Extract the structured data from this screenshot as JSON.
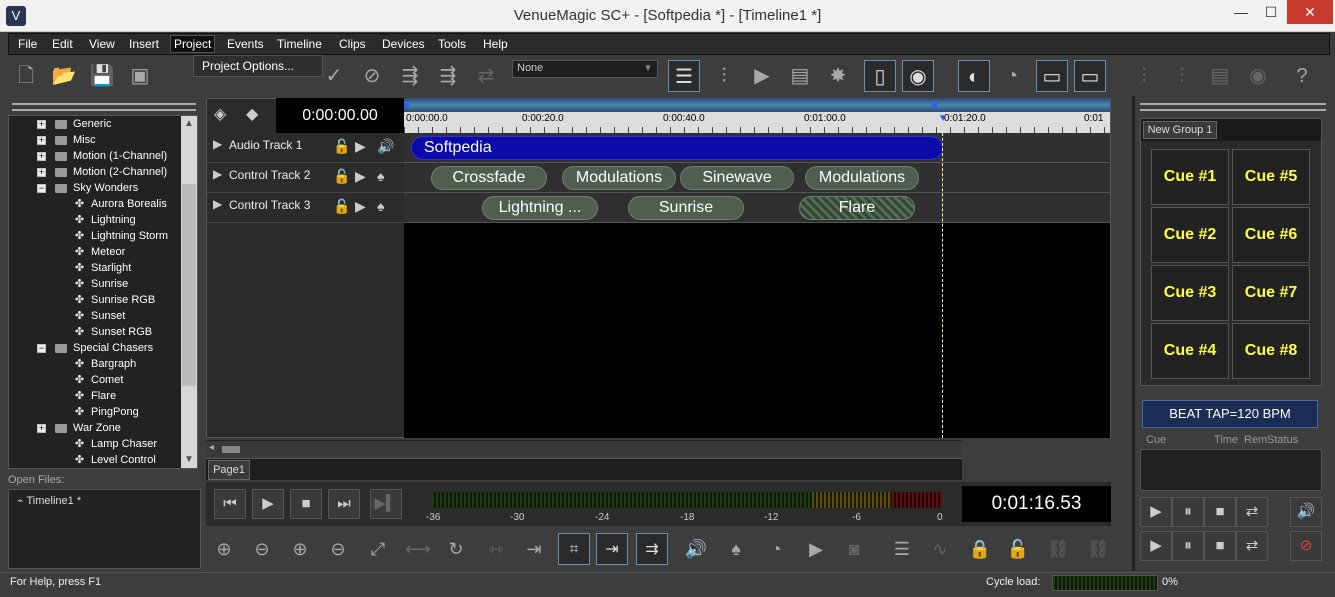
{
  "window": {
    "title": "VenueMagic SC+ - [Softpedia *] - [Timeline1 *]",
    "controls": {
      "minimize": "—",
      "maximize": "☐",
      "close": "✕"
    }
  },
  "menu": {
    "items": [
      "File",
      "Edit",
      "View",
      "Insert",
      "Project",
      "Events",
      "Timeline",
      "Clips",
      "Devices",
      "Tools",
      "Help"
    ],
    "active": "Project",
    "popup_item": "Project Options..."
  },
  "toolbar": {
    "dropdown_value": "None"
  },
  "tree": {
    "items": [
      {
        "label": "Generic",
        "type": "folder",
        "expander": "+"
      },
      {
        "label": "Misc",
        "type": "folder",
        "expander": "+"
      },
      {
        "label": "Motion (1-Channel)",
        "type": "folder",
        "expander": "+"
      },
      {
        "label": "Motion (2-Channel)",
        "type": "folder",
        "expander": "+"
      },
      {
        "label": "Sky Wonders",
        "type": "folder",
        "expander": "−"
      },
      {
        "label": "Aurora Borealis",
        "type": "effect"
      },
      {
        "label": "Lightning",
        "type": "effect"
      },
      {
        "label": "Lightning Storm",
        "type": "effect"
      },
      {
        "label": "Meteor",
        "type": "effect"
      },
      {
        "label": "Starlight",
        "type": "effect"
      },
      {
        "label": "Sunrise",
        "type": "effect"
      },
      {
        "label": "Sunrise RGB",
        "type": "effect"
      },
      {
        "label": "Sunset",
        "type": "effect"
      },
      {
        "label": "Sunset RGB",
        "type": "effect"
      },
      {
        "label": "Special Chasers",
        "type": "folder",
        "expander": "−"
      },
      {
        "label": "Bargraph",
        "type": "effect"
      },
      {
        "label": "Comet",
        "type": "effect"
      },
      {
        "label": "Flare",
        "type": "effect"
      },
      {
        "label": "PingPong",
        "type": "effect"
      },
      {
        "label": "War Zone",
        "type": "folder",
        "expander": "+"
      },
      {
        "label": "Lamp Chaser",
        "type": "effect"
      },
      {
        "label": "Level Control",
        "type": "effect"
      }
    ]
  },
  "open_files": {
    "label": "Open Files:",
    "items": [
      "Timeline1 *"
    ]
  },
  "timeline": {
    "time_display": "0:00:00.00",
    "ruler": [
      "0:00:00.0",
      "0:00:20.0",
      "0:00:40.0",
      "0:01:00.0",
      "0:01:20.0",
      "0:01"
    ],
    "tracks": [
      {
        "name": "Audio Track 1"
      },
      {
        "name": "Control Track 2"
      },
      {
        "name": "Control Track 3"
      }
    ],
    "clips": {
      "track1": [
        "Softpedia"
      ],
      "track2": [
        "Crossfade",
        "Modulations",
        "Sinewave",
        "Modulations"
      ],
      "track3": [
        "Lightning ...",
        "Sunrise",
        "Flare"
      ]
    },
    "page_tab": "Page1"
  },
  "transport": {
    "elapsed": "0:01:16.53",
    "meter_scale": [
      "-36",
      "-30",
      "-24",
      "-18",
      "-12",
      "-6",
      "0"
    ]
  },
  "cues": {
    "group_tab": "New Group 1",
    "buttons": [
      "Cue #1",
      "Cue #5",
      "Cue #2",
      "Cue #6",
      "Cue #3",
      "Cue #7",
      "Cue #4",
      "Cue #8"
    ],
    "beat_tap": "BEAT TAP=120 BPM",
    "list_headers": [
      "Cue",
      "Time",
      "Rem",
      "Status"
    ]
  },
  "status": {
    "help": "For Help, press F1",
    "cycle_label": "Cycle load:",
    "cycle_value": "0%"
  },
  "colors": {
    "clip_blue": "#0a0aa8",
    "clip_green": "#4f5e4f",
    "cue_text": "#ffff44",
    "playhead": "#ffff99"
  }
}
